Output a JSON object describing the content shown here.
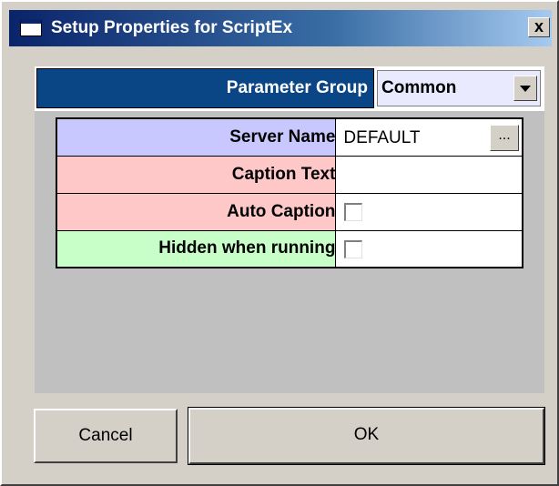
{
  "window": {
    "title": "Setup Properties for ScriptEx",
    "close_label": "x"
  },
  "parameter_group": {
    "label": "Parameter Group",
    "selected": "Common"
  },
  "properties": [
    {
      "label": "Server Name",
      "value": "DEFAULT",
      "type": "text-browse",
      "color": "#c8c8ff"
    },
    {
      "label": "Caption Text",
      "value": "",
      "type": "text",
      "color": "#ffc8c8"
    },
    {
      "label": "Auto Caption",
      "checked": false,
      "type": "checkbox",
      "color": "#ffc8c8"
    },
    {
      "label": "Hidden when running",
      "checked": false,
      "type": "checkbox",
      "color": "#c8ffc8"
    }
  ],
  "browse_button_label": "...",
  "buttons": {
    "cancel": "Cancel",
    "ok": "OK"
  },
  "colors": {
    "group_label_bg": "#0a4686",
    "titlebar_start": "#0a246a",
    "titlebar_end": "#a6caf0",
    "panel_bg": "#c0c0c0",
    "dialog_bg": "#d4d0c8"
  }
}
